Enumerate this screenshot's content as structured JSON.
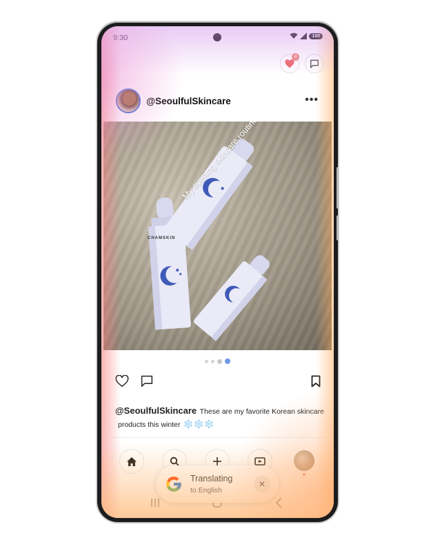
{
  "status_bar": {
    "time": "9:30",
    "battery": "100"
  },
  "top_actions": {
    "notifications_count": "4"
  },
  "post": {
    "handle": "@SeoulfulSkincare",
    "more_label": "•••",
    "photo_overlay_text": "My evening skincare routine",
    "brand_text": "CHAMSKIN",
    "carousel": {
      "count": 4,
      "active_index": 3
    }
  },
  "caption": {
    "handle": "@SeoulfulSkincare",
    "line1": "These are my favorite Korean skincare",
    "line2": "products this winter",
    "emoji": "❄️❄️❄️"
  },
  "bottom_nav": {
    "items": [
      "home-icon",
      "search-icon",
      "plus-icon",
      "video-icon",
      "profile-avatar"
    ]
  },
  "translate_chip": {
    "title": "Translating",
    "subtitle": "to English",
    "close": "✕"
  },
  "colors": {
    "accent_blue": "#6f98e8",
    "badge_red": "#f28b82",
    "heart_red": "#f06a6a"
  }
}
